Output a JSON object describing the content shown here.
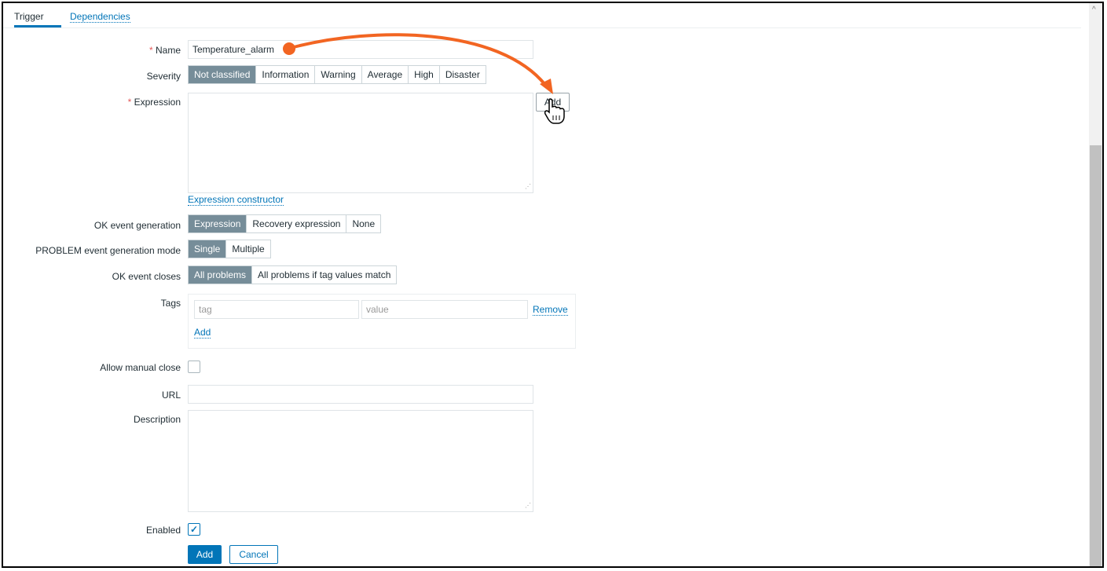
{
  "tabs": [
    {
      "label": "Trigger"
    },
    {
      "label": "Dependencies"
    }
  ],
  "form": {
    "name": {
      "label": "Name",
      "required_mark": "*",
      "value": "Temperature_alarm"
    },
    "severity": {
      "label": "Severity",
      "options": [
        "Not classified",
        "Information",
        "Warning",
        "Average",
        "High",
        "Disaster"
      ],
      "selected": "Not classified"
    },
    "expression": {
      "label": "Expression",
      "required_mark": "*",
      "value": "",
      "add_button": "Add",
      "constructor_link": "Expression constructor"
    },
    "ok_event_generation": {
      "label": "OK event generation",
      "options": [
        "Expression",
        "Recovery expression",
        "None"
      ],
      "selected": "Expression"
    },
    "problem_mode": {
      "label": "PROBLEM event generation mode",
      "options": [
        "Single",
        "Multiple"
      ],
      "selected": "Single"
    },
    "ok_event_closes": {
      "label": "OK event closes",
      "options": [
        "All problems",
        "All problems if tag values match"
      ],
      "selected": "All problems"
    },
    "tags": {
      "label": "Tags",
      "tag_placeholder": "tag",
      "value_placeholder": "value",
      "remove_link": "Remove",
      "add_link": "Add"
    },
    "allow_manual_close": {
      "label": "Allow manual close",
      "checked": false
    },
    "url": {
      "label": "URL",
      "value": ""
    },
    "description": {
      "label": "Description",
      "value": ""
    },
    "enabled": {
      "label": "Enabled",
      "checked": true
    },
    "buttons": {
      "add": "Add",
      "cancel": "Cancel"
    }
  },
  "annotation": {
    "arrow_color": "#f26522",
    "cursor": "hand-pointer-icon"
  },
  "colors": {
    "accent": "#0275b8",
    "selected_segment": "#768d99",
    "required": "#e45959"
  }
}
